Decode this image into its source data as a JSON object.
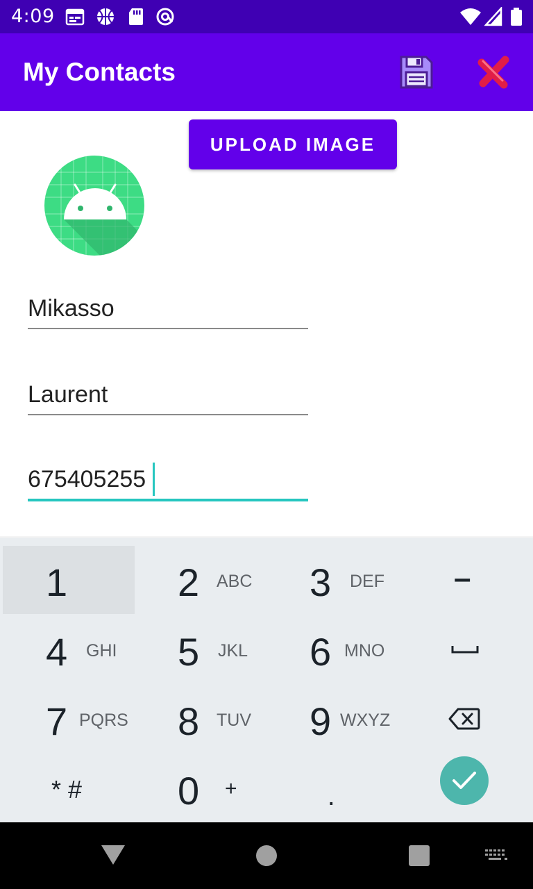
{
  "status_bar": {
    "time": "4:09",
    "icons": [
      "calendar-icon",
      "basketball-icon",
      "sd-card-icon",
      "at-sync-icon",
      "wifi-icon",
      "signal-icon",
      "battery-icon"
    ]
  },
  "app_bar": {
    "title": "My Contacts",
    "actions": [
      "save-icon",
      "close-icon"
    ]
  },
  "form": {
    "upload_button_label": "UPLOAD IMAGE",
    "first_name": "Mikasso",
    "last_name": "Laurent",
    "phone": "675405255"
  },
  "keyboard": {
    "keys": [
      {
        "digit": "1",
        "letters": ""
      },
      {
        "digit": "2",
        "letters": "ABC"
      },
      {
        "digit": "3",
        "letters": "DEF"
      },
      {
        "digit": "–",
        "letters": ""
      },
      {
        "digit": "4",
        "letters": "GHI"
      },
      {
        "digit": "5",
        "letters": "JKL"
      },
      {
        "digit": "6",
        "letters": "MNO"
      },
      {
        "digit": "4",
        "letters": "GHI"
      },
      {
        "digit": "7",
        "letters": "PQRS"
      },
      {
        "digit": "8",
        "letters": "TUV"
      },
      {
        "digit": "9",
        "letters": "WXYZ"
      },
      {
        "digit": "*#",
        "letters": ""
      },
      {
        "digit": "0",
        "letters": "+"
      },
      {
        "digit": ".",
        "letters": ""
      }
    ],
    "row1": [
      {
        "digit": "1",
        "letters": ""
      },
      {
        "digit": "2",
        "letters": "ABC"
      },
      {
        "digit": "3",
        "letters": "DEF"
      },
      {
        "digit": "–",
        "letters": ""
      }
    ],
    "row2": [
      {
        "digit": "4",
        "letters": "GHI"
      },
      {
        "digit": "5",
        "letters": "JKL"
      },
      {
        "digit": "6",
        "letters": "MNO"
      }
    ],
    "row3": [
      {
        "digit": "7",
        "letters": "PQRS"
      },
      {
        "digit": "8",
        "letters": "TUV"
      },
      {
        "digit": "9",
        "letters": "WXYZ"
      }
    ],
    "row4": [
      {
        "digit": "* #",
        "letters": ""
      },
      {
        "digit": "0",
        "letters": "+"
      },
      {
        "digit": ".",
        "letters": ""
      }
    ],
    "special_icons": [
      "space-icon",
      "backspace-icon",
      "enter-check-icon"
    ]
  },
  "nav_bar": {
    "icons": [
      "back-triangle-icon",
      "home-circle-icon",
      "recents-square-icon",
      "keyboard-switch-icon"
    ]
  },
  "colors": {
    "status_bar": "#3f00b3",
    "app_bar": "#6200ea",
    "accent_teal": "#26c6bf",
    "keyboard_bg": "#e9edf0",
    "enter_key": "#4db6ac"
  }
}
